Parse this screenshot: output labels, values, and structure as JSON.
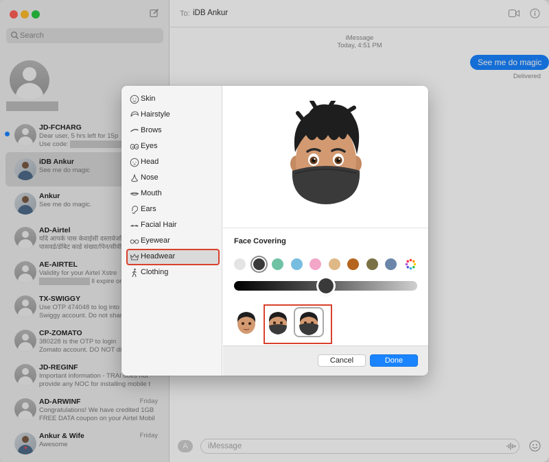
{
  "sidebar": {
    "search_placeholder": "Search",
    "conversations": [
      {
        "name": "JD-FCHARG",
        "line1": "Dear user, 5 hrs left for 15p",
        "line2": "Use code:",
        "time": "",
        "unread": true
      },
      {
        "name": "iDB Ankur",
        "line1": "See me do magic",
        "line2": "",
        "time": ""
      },
      {
        "name": "Ankur",
        "line1": "See me do magic.",
        "line2": "",
        "time": ""
      },
      {
        "name": "AD-Airtel",
        "line1": "यदि आपके पास केवाईसी दस्तावेजों",
        "line2": "पासवर्ड/डेबिट कार्ड संख्या/पिन/सीवी",
        "time": ""
      },
      {
        "name": "AE-AIRTEL",
        "line1": "Validity for your Airtel Xstre",
        "line2": "ll expire on",
        "time": ""
      },
      {
        "name": "TX-SWIGGY",
        "line1": "Use OTP 474048 to log into",
        "line2": "Swiggy account. Do not shar",
        "time": ""
      },
      {
        "name": "CP-ZOMATO",
        "line1": "380228 is the OTP to login",
        "line2": "Zomato account. DO NOT di",
        "time": ""
      },
      {
        "name": "JD-REGINF",
        "line1": "Important information - TRAI does not",
        "line2": "provide any NOC for installing mobile t",
        "time": ""
      },
      {
        "name": "AD-ARWINF",
        "line1": "Congratulations! We have credited 1GB",
        "line2": "FREE DATA coupon on your Airtel Mobil",
        "time": "Friday"
      },
      {
        "name": "Ankur & Wife",
        "line1": "Awesome",
        "line2": "",
        "time": "Friday"
      }
    ]
  },
  "chat": {
    "to_label": "To:",
    "recipient": "iDB Ankur",
    "service": "iMessage",
    "timestamp": "Today, 4:51 PM",
    "message": "See me do magic",
    "status": "Delivered",
    "input_placeholder": "iMessage"
  },
  "editor": {
    "categories": [
      {
        "label": "Skin",
        "icon": "skin-icon"
      },
      {
        "label": "Hairstyle",
        "icon": "hairstyle-icon"
      },
      {
        "label": "Brows",
        "icon": "brows-icon"
      },
      {
        "label": "Eyes",
        "icon": "eyes-icon"
      },
      {
        "label": "Head",
        "icon": "head-icon"
      },
      {
        "label": "Nose",
        "icon": "nose-icon"
      },
      {
        "label": "Mouth",
        "icon": "mouth-icon"
      },
      {
        "label": "Ears",
        "icon": "ears-icon"
      },
      {
        "label": "Facial Hair",
        "icon": "mustache-icon"
      },
      {
        "label": "Eyewear",
        "icon": "glasses-icon"
      },
      {
        "label": "Headwear",
        "icon": "crown-icon",
        "selected": true
      },
      {
        "label": "Clothing",
        "icon": "person-walking-icon"
      }
    ],
    "section_title": "Face Covering",
    "colors": [
      "#e4e4e4",
      "#3a3a3a",
      "#6fc3a4",
      "#77bde0",
      "#f4a6c8",
      "#deb887",
      "#b5651d",
      "#7a7246",
      "#6b86a8"
    ],
    "selected_color_index": 1,
    "slider_value": 0.5,
    "selected_variant_index": 2,
    "cancel_label": "Cancel",
    "done_label": "Done",
    "accent": "#1a84ff",
    "highlight": "#d8402c"
  }
}
